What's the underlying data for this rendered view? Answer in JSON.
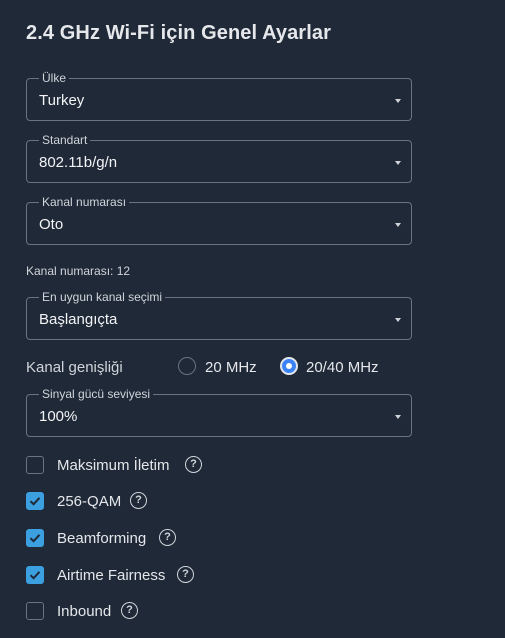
{
  "page": {
    "title": "2.4 GHz Wi-Fi için Genel Ayarlar"
  },
  "fields": {
    "country": {
      "legend": "Ülke",
      "value": "Turkey"
    },
    "standard": {
      "legend": "Standart",
      "value": "802.11b/g/n"
    },
    "channel": {
      "legend": "Kanal numarası",
      "value": "Oto"
    },
    "channel_hint": "Kanal numarası: 12",
    "best_channel": {
      "legend": "En uygun kanal seçimi",
      "value": "Başlangıçta"
    },
    "bandwidth": {
      "label": "Kanal genişliği",
      "options": [
        {
          "label": "20 MHz",
          "selected": false
        },
        {
          "label": "20/40 MHz",
          "selected": true
        }
      ]
    },
    "signal_power": {
      "legend": "Sinyal gücü seviyesi",
      "value": "100%"
    }
  },
  "checkboxes": [
    {
      "label": "Maksimum İletim",
      "checked": false
    },
    {
      "label": "256-QAM",
      "checked": true
    },
    {
      "label": "Beamforming",
      "checked": true
    },
    {
      "label": "Airtime Fairness",
      "checked": true
    },
    {
      "label": "Inbound",
      "checked": false
    }
  ],
  "help_glyph": "?",
  "colors": {
    "background": "#1f2937",
    "accent": "#3b9fe0",
    "text": "#e5e7eb"
  }
}
